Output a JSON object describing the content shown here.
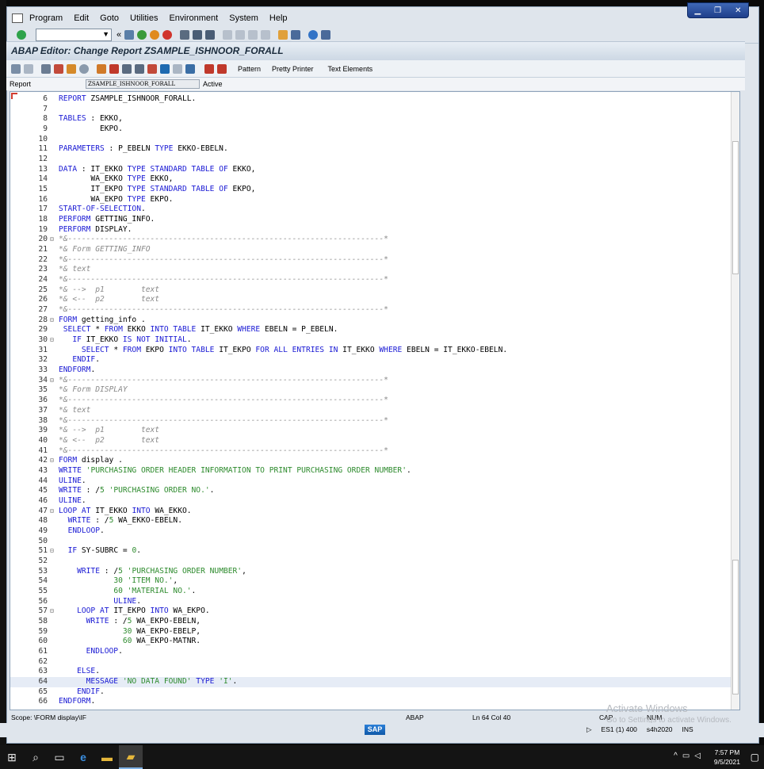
{
  "menubar": {
    "items": [
      "Program",
      "Edit",
      "Goto",
      "Utilities",
      "Environment",
      "System",
      "Help"
    ]
  },
  "title": {
    "text": "ABAP Editor: Change Report ZSAMPLE_ISHNOOR_FORALL"
  },
  "app_toolbar": {
    "pattern": "Pattern",
    "pretty_printer": "Pretty Printer",
    "text_elements": "Text Elements"
  },
  "report": {
    "label": "Report",
    "name": "ZSAMPLE_ISHNOOR_FORALL",
    "status": "Active"
  },
  "editor": {
    "cursor_line": 64,
    "lines": [
      {
        "n": "6",
        "f": "",
        "t": "REPORT ZSAMPLE_ISHNOOR_FORALL."
      },
      {
        "n": "7",
        "f": "",
        "t": ""
      },
      {
        "n": "8",
        "f": "",
        "t": "TABLES : EKKO,"
      },
      {
        "n": "9",
        "f": "",
        "t": "         EKPO."
      },
      {
        "n": "10",
        "f": "",
        "t": ""
      },
      {
        "n": "11",
        "f": "",
        "t": "PARAMETERS : P_EBELN TYPE EKKO-EBELN."
      },
      {
        "n": "12",
        "f": "",
        "t": ""
      },
      {
        "n": "13",
        "f": "",
        "t": "DATA : IT_EKKO TYPE STANDARD TABLE OF EKKO,"
      },
      {
        "n": "14",
        "f": "",
        "t": "       WA_EKKO TYPE EKKO,"
      },
      {
        "n": "15",
        "f": "",
        "t": "       IT_EKPO TYPE STANDARD TABLE OF EKPO,"
      },
      {
        "n": "16",
        "f": "",
        "t": "       WA_EKPO TYPE EKPO."
      },
      {
        "n": "17",
        "f": "",
        "t": "START-OF-SELECTION."
      },
      {
        "n": "18",
        "f": "",
        "t": "PERFORM GETTING_INFO."
      },
      {
        "n": "19",
        "f": "",
        "t": "PERFORM DISPLAY."
      },
      {
        "n": "20",
        "f": "⊟",
        "t": "*&---------------------------------------------------------------------*"
      },
      {
        "n": "21",
        "f": "",
        "t": "*& Form GETTING_INFO"
      },
      {
        "n": "22",
        "f": "",
        "t": "*&---------------------------------------------------------------------*"
      },
      {
        "n": "23",
        "f": "",
        "t": "*& text"
      },
      {
        "n": "24",
        "f": "",
        "t": "*&---------------------------------------------------------------------*"
      },
      {
        "n": "25",
        "f": "",
        "t": "*& -->  p1        text"
      },
      {
        "n": "26",
        "f": "",
        "t": "*& <--  p2        text"
      },
      {
        "n": "27",
        "f": "",
        "t": "*&---------------------------------------------------------------------*"
      },
      {
        "n": "28",
        "f": "⊟",
        "t": "FORM getting_info ."
      },
      {
        "n": "29",
        "f": "",
        "t": " SELECT * FROM EKKO INTO TABLE IT_EKKO WHERE EBELN = P_EBELN."
      },
      {
        "n": "30",
        "f": "⊟",
        "t": "   IF IT_EKKO IS NOT INITIAL."
      },
      {
        "n": "31",
        "f": "",
        "t": "     SELECT * FROM EKPO INTO TABLE IT_EKPO FOR ALL ENTRIES IN IT_EKKO WHERE EBELN = IT_EKKO-EBELN."
      },
      {
        "n": "32",
        "f": "",
        "t": "   ENDIF."
      },
      {
        "n": "33",
        "f": "",
        "t": "ENDFORM."
      },
      {
        "n": "34",
        "f": "⊟",
        "t": "*&---------------------------------------------------------------------*"
      },
      {
        "n": "35",
        "f": "",
        "t": "*& Form DISPLAY"
      },
      {
        "n": "36",
        "f": "",
        "t": "*&---------------------------------------------------------------------*"
      },
      {
        "n": "37",
        "f": "",
        "t": "*& text"
      },
      {
        "n": "38",
        "f": "",
        "t": "*&---------------------------------------------------------------------*"
      },
      {
        "n": "39",
        "f": "",
        "t": "*& -->  p1        text"
      },
      {
        "n": "40",
        "f": "",
        "t": "*& <--  p2        text"
      },
      {
        "n": "41",
        "f": "",
        "t": "*&---------------------------------------------------------------------*"
      },
      {
        "n": "42",
        "f": "⊟",
        "t": "FORM display ."
      },
      {
        "n": "43",
        "f": "",
        "t": "WRITE 'PURCHASING ORDER HEADER INFORMATION TO PRINT PURCHASING ORDER NUMBER'."
      },
      {
        "n": "44",
        "f": "",
        "t": "ULINE."
      },
      {
        "n": "45",
        "f": "",
        "t": "WRITE : /5 'PURCHASING ORDER NO.'."
      },
      {
        "n": "46",
        "f": "",
        "t": "ULINE."
      },
      {
        "n": "47",
        "f": "⊟",
        "t": "LOOP AT IT_EKKO INTO WA_EKKO."
      },
      {
        "n": "48",
        "f": "",
        "t": "  WRITE : /5 WA_EKKO-EBELN."
      },
      {
        "n": "49",
        "f": "",
        "t": "  ENDLOOP."
      },
      {
        "n": "50",
        "f": "",
        "t": ""
      },
      {
        "n": "51",
        "f": "⊟",
        "t": "  IF SY-SUBRC = 0."
      },
      {
        "n": "52",
        "f": "",
        "t": ""
      },
      {
        "n": "53",
        "f": "",
        "t": "    WRITE : /5 'PURCHASING ORDER NUMBER',"
      },
      {
        "n": "54",
        "f": "",
        "t": "            30 'ITEM NO.',"
      },
      {
        "n": "55",
        "f": "",
        "t": "            60 'MATERIAL NO.'."
      },
      {
        "n": "56",
        "f": "",
        "t": "            ULINE."
      },
      {
        "n": "57",
        "f": "⊟",
        "t": "    LOOP AT IT_EKPO INTO WA_EKPO."
      },
      {
        "n": "58",
        "f": "",
        "t": "      WRITE : /5 WA_EKPO-EBELN,"
      },
      {
        "n": "59",
        "f": "",
        "t": "              30 WA_EKPO-EBELP,"
      },
      {
        "n": "60",
        "f": "",
        "t": "              60 WA_EKPO-MATNR."
      },
      {
        "n": "61",
        "f": "",
        "t": "      ENDLOOP."
      },
      {
        "n": "62",
        "f": "",
        "t": ""
      },
      {
        "n": "63",
        "f": "",
        "t": "    ELSE."
      },
      {
        "n": "64",
        "f": "",
        "t": "      MESSAGE 'NO DATA FOUND' TYPE 'I'."
      },
      {
        "n": "65",
        "f": "",
        "t": "    ENDIF."
      },
      {
        "n": "66",
        "f": "",
        "t": "ENDFORM."
      }
    ]
  },
  "status_line": {
    "scope": "Scope: \\FORM display\\IF",
    "language": "ABAP",
    "position": "Ln  64 Col  40",
    "cap": "CAP",
    "num": "NUM"
  },
  "status_bar": {
    "system": "ES1 (1) 400",
    "server": "s4h2020",
    "mode": "INS",
    "logo": "SAP"
  },
  "watermark": {
    "line1": "Activate Windows",
    "line2": "Go to Settings to activate Windows."
  },
  "taskbar": {
    "time": "7:57 PM",
    "date": "9/5/2021"
  }
}
